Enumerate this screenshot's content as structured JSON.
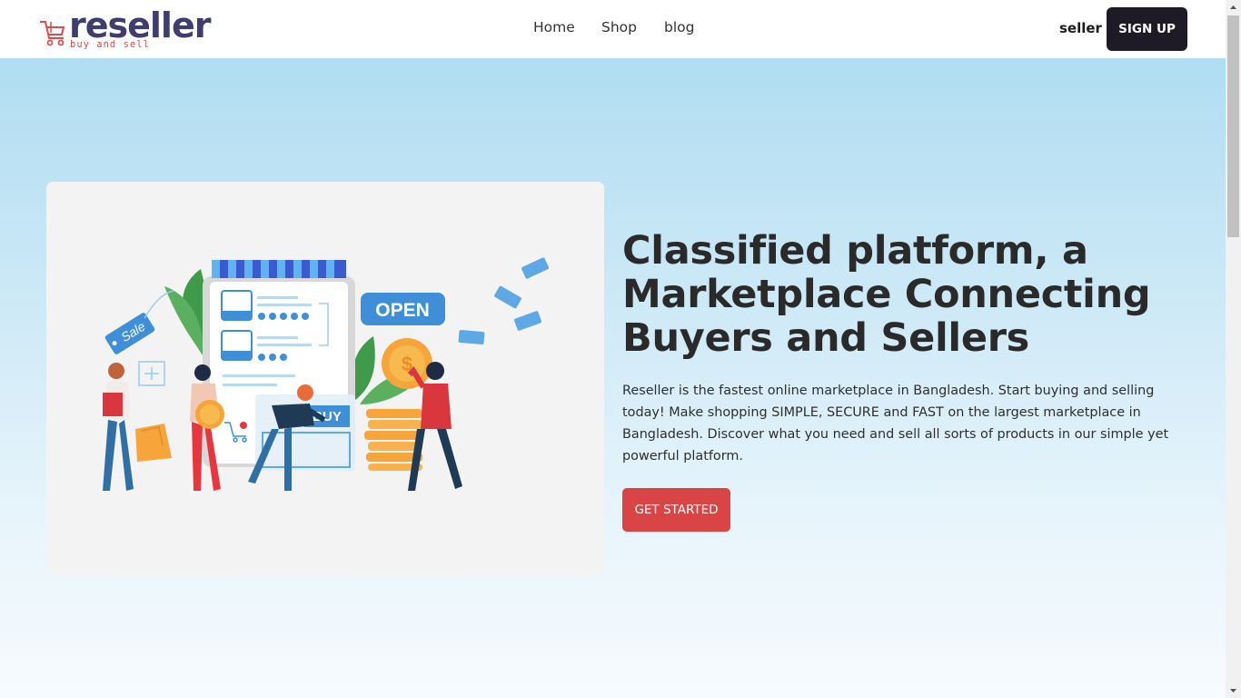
{
  "header": {
    "logo_word": "reseller",
    "logo_tagline": "buy and sell",
    "nav": [
      {
        "label": "Home"
      },
      {
        "label": "Shop"
      },
      {
        "label": "blog"
      }
    ],
    "seller_label": "seller",
    "signup_label": "SIGN UP"
  },
  "hero": {
    "title": "Classified platform, a Marketplace Connecting Buyers and Sellers",
    "description": "Reseller is the fastest online marketplace in Bangladesh. Start buying and selling today! Make shopping SIMPLE, SECURE and FAST on the largest marketplace in Bangladesh. Discover what you need and sell all sorts of products in our simple yet powerful platform.",
    "cta_label": "GET STARTED",
    "illustration": {
      "tag_text": "Sale",
      "sign_text": "OPEN",
      "button_text": "BUY"
    }
  },
  "colors": {
    "brand": "#3f3c6e",
    "accent_red": "#d94545",
    "signup_bg": "#1e1b26",
    "hero_top": "#b0ddf1",
    "hero_bottom": "#f7fbfe"
  }
}
